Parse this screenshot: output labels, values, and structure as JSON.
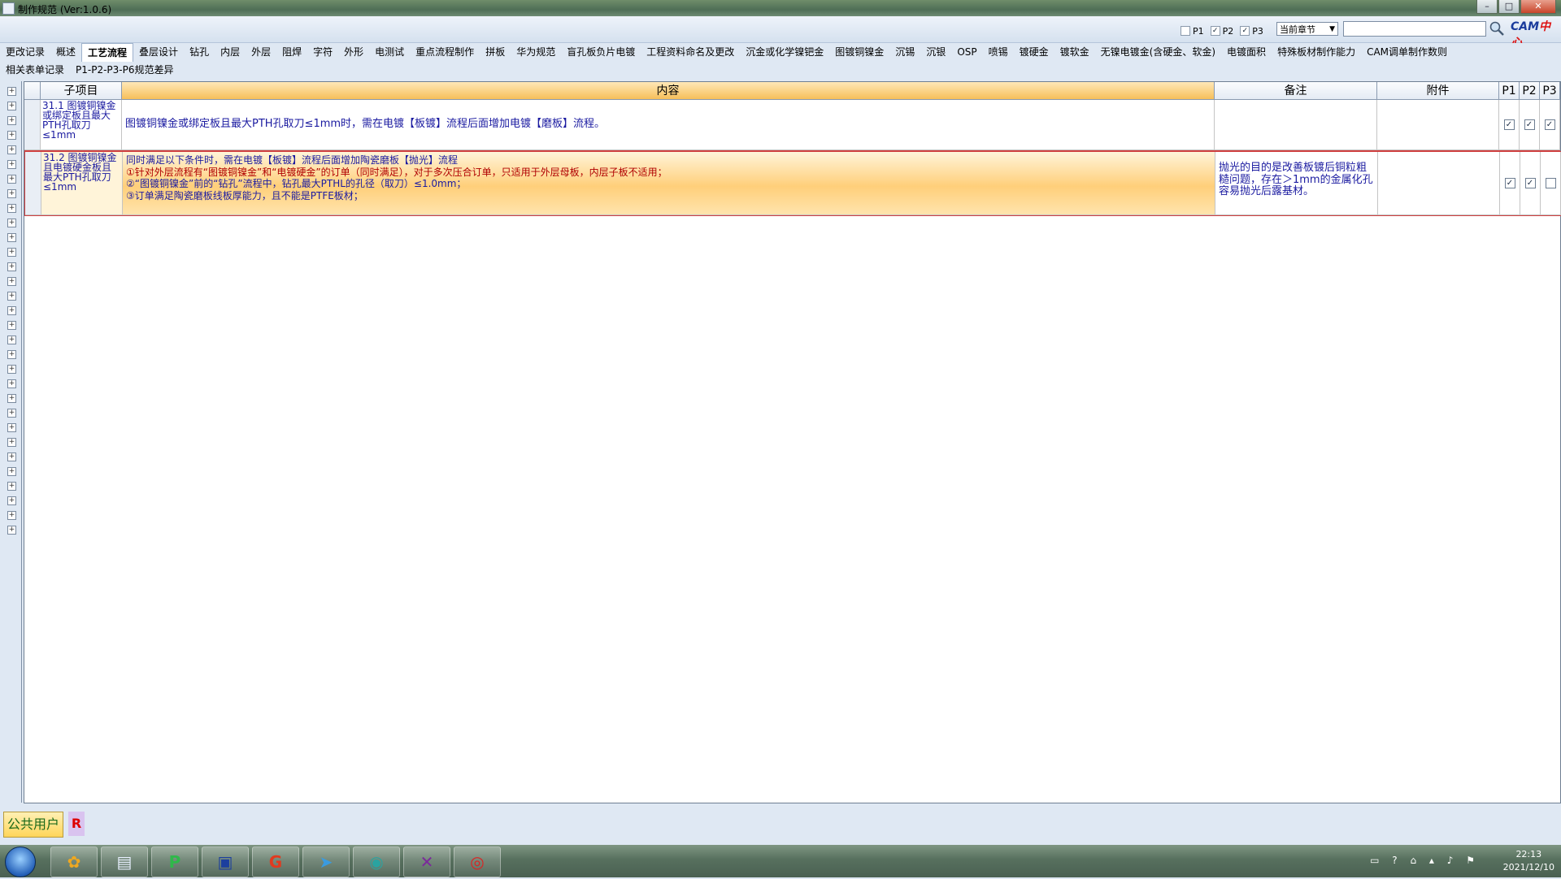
{
  "window": {
    "title": "制作规范 (Ver:1.0.6)"
  },
  "toolbar": {
    "filters": [
      {
        "label": "P1",
        "checked": false
      },
      {
        "label": "P2",
        "checked": true
      },
      {
        "label": "P3",
        "checked": true
      }
    ],
    "scope_select": "当前章节",
    "search_value": "",
    "logo_main": "CAM",
    "logo_accent": "中心"
  },
  "tabs_row1": [
    "更改记录",
    "概述",
    "工艺流程",
    "叠层设计",
    "钻孔",
    "内层",
    "外层",
    "阻焊",
    "字符",
    "外形",
    "电测试",
    "重点流程制作",
    "拼板",
    "华为规范",
    "盲孔板负片电镀",
    "工程资料命名及更改",
    "沉金或化学镍钯金",
    "图镀铜镍金",
    "沉锡",
    "沉银",
    "OSP",
    "喷锡",
    "镀硬金",
    "镀软金",
    "无镍电镀金(含硬金、软金)",
    "电镀面积",
    "特殊板材制作能力",
    "CAM调单制作数则"
  ],
  "tabs_row2": [
    "相关表单记录",
    "P1-P2-P3-P6规范差异"
  ],
  "active_tab": "工艺流程",
  "grid": {
    "headers": {
      "sub": "子项目",
      "content": "内容",
      "note": "备注",
      "attachment": "附件",
      "p1": "P1",
      "p2": "P2",
      "p3": "P3"
    },
    "rows": [
      {
        "sub": "31.1 图镀铜镍金或绑定板且最大PTH孔取刀≤1mm",
        "content_lines": [
          "图镀铜镍金或绑定板且最大PTH孔取刀≤1mm时，需在电镀【板镀】流程后面增加电镀【磨板】流程。"
        ],
        "note": "",
        "p1": true,
        "p2": true,
        "p3": true
      },
      {
        "sub": "31.2 图镀铜镍金且电镀硬金板且最大PTH孔取刀≤1mm",
        "content_lines": [
          "同时满足以下条件时，需在电镀【板镀】流程后面增加陶瓷磨板【抛光】流程",
          "①针对外层流程有“图镀铜镍金”和“电镀硬金”的订单（同时满足），对于多次压合订单，只适用于外层母板，内层子板不适用；",
          "②“图镀铜镍金”前的“钻孔”流程中，钻孔最大PTHL的孔径（取刀）≤1.0mm；",
          "③订单满足陶瓷磨板线板厚能力，且不能是PTFE板材；"
        ],
        "note": "抛光的目的是改善板镀后铜粒粗糙问题，存在＞1mm的金属化孔容易抛光后露基材。",
        "p1": true,
        "p2": true,
        "p3": false
      }
    ]
  },
  "status": {
    "user": "公共用户",
    "role_badge": "R"
  },
  "taskbar": {
    "apps": [
      {
        "name": "sunflower-icon",
        "glyph": "✿",
        "color": "#f0a820"
      },
      {
        "name": "document-icon",
        "glyph": "▤",
        "color": "#e8f0ff"
      },
      {
        "name": "p-app-icon",
        "glyph": "P",
        "color": "#2fb84a"
      },
      {
        "name": "floppy-disk-icon",
        "glyph": "▣",
        "color": "#1c3f9e"
      },
      {
        "name": "g-app-icon",
        "glyph": "G",
        "color": "#e23a1f"
      },
      {
        "name": "paper-plane-icon",
        "glyph": "➤",
        "color": "#3a9be0"
      },
      {
        "name": "eye-app-icon",
        "glyph": "◉",
        "color": "#2aa3a0"
      },
      {
        "name": "x-app-icon",
        "glyph": "✕",
        "color": "#7b2a9a"
      },
      {
        "name": "target-app-icon",
        "glyph": "◎",
        "color": "#d22"
      }
    ],
    "time": "22:13",
    "date": "2021/12/10"
  }
}
